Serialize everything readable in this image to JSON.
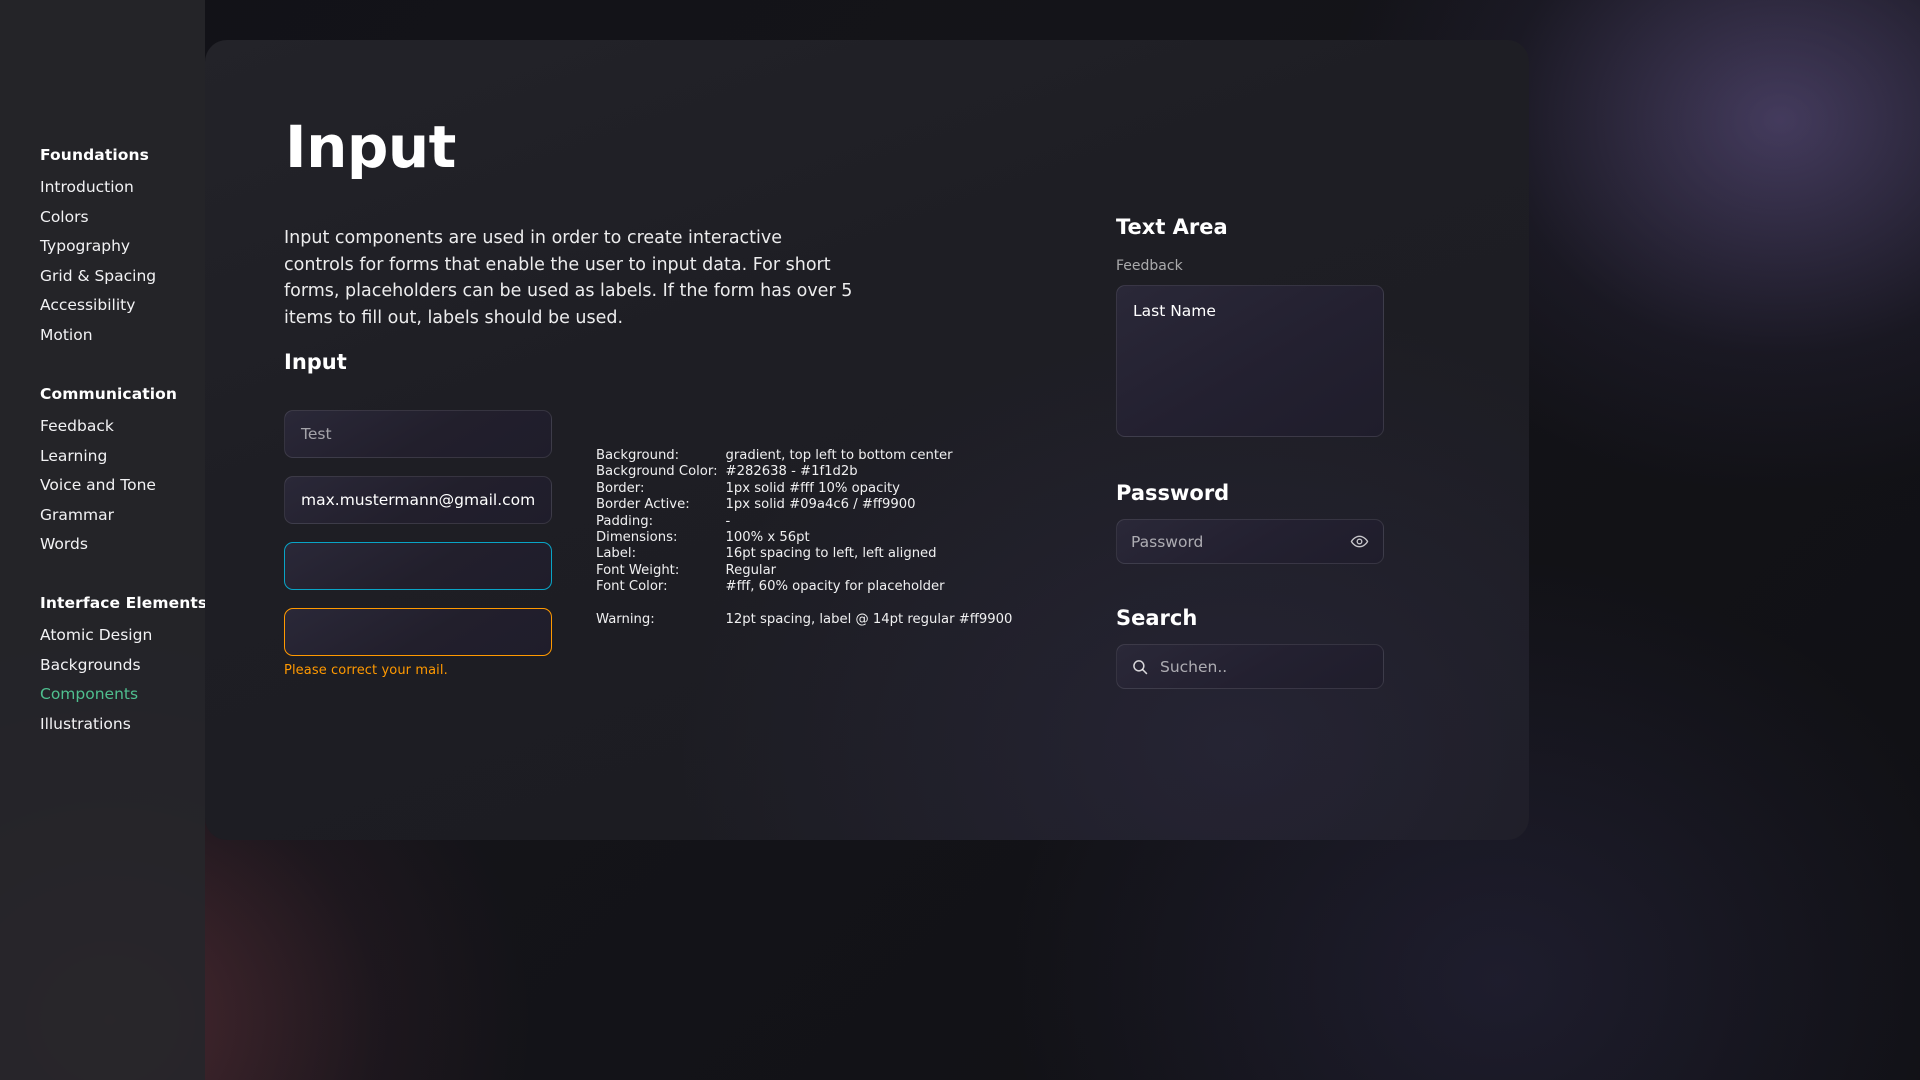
{
  "sidebar": {
    "groups": [
      {
        "title": "Foundations",
        "items": [
          "Introduction",
          "Colors",
          "Typography",
          "Grid & Spacing",
          "Accessibility",
          "Motion"
        ]
      },
      {
        "title": "Communication",
        "items": [
          "Feedback",
          "Learning",
          "Voice and Tone",
          "Grammar",
          "Words"
        ]
      },
      {
        "title": "Interface Elements",
        "items": [
          "Atomic Design",
          "Backgrounds",
          "Components",
          "Illustrations"
        ]
      }
    ],
    "active_item": "Components",
    "active_color": "#4fbf8f"
  },
  "main": {
    "title": "Input",
    "description": "Input components are used in order to create interactive controls for forms that enable the user to input data. For short forms, placeholders can be used as labels. If the form has over 5 items to fill out, labels should be used.",
    "section_title": "Input",
    "fields": {
      "default_value": "Test",
      "filled_value": "max.mustermann@gmail.com",
      "focused_value": "",
      "error_value": "",
      "error_message": "Please correct your mail."
    },
    "spec": {
      "rows": [
        {
          "key": "Background:",
          "value": "gradient, top left to bottom center"
        },
        {
          "key": "Background Color:",
          "value": "#282638 - #1f1d2b"
        },
        {
          "key": "Border:",
          "value": "1px solid #fff 10% opacity"
        },
        {
          "key": "Border Active:",
          "value": "1px solid #09a4c6 / #ff9900"
        },
        {
          "key": "Padding:",
          "value": "-"
        },
        {
          "key": "Dimensions:",
          "value": "100% x 56pt"
        },
        {
          "key": "Label:",
          "value": "16pt spacing to left, left aligned"
        },
        {
          "key": "Font Weight:",
          "value": "Regular"
        },
        {
          "key": "Font Color:",
          "value": "#fff, 60% opacity for placeholder"
        }
      ],
      "warning_key": "Warning:",
      "warning_value": "12pt spacing, label @ 14pt regular #ff9900"
    }
  },
  "right": {
    "textarea": {
      "title": "Text Area",
      "label": "Feedback",
      "value": "Last Name"
    },
    "password": {
      "title": "Password",
      "placeholder": "Password",
      "toggle_icon": "eye-icon"
    },
    "search": {
      "title": "Search",
      "placeholder": "Suchen..",
      "icon": "search-icon"
    }
  },
  "colors": {
    "focus_border": "#09a4c6",
    "error_border": "#ff9900",
    "error_text": "#ff9900",
    "accent_nav": "#4fbf8f",
    "field_gradient_start": "#282638",
    "field_gradient_end": "#1f1d2b"
  }
}
